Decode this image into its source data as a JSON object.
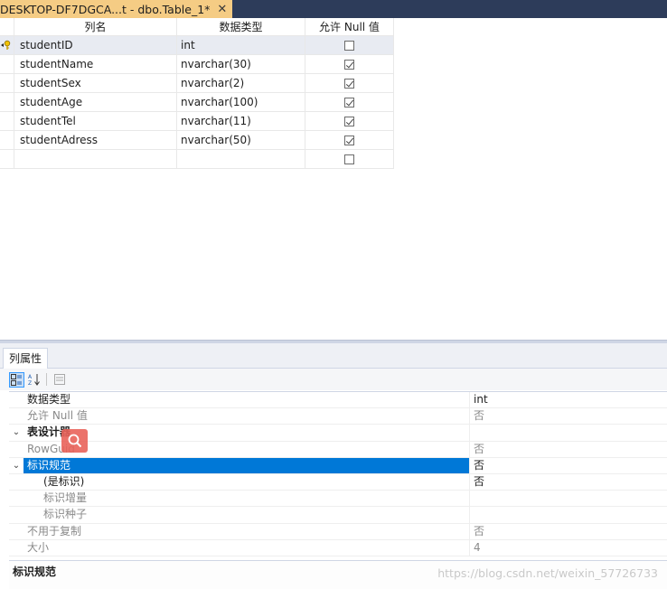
{
  "tab": {
    "title": "DESKTOP-DF7DGCA...t - dbo.Table_1*",
    "close_glyph": "✕"
  },
  "grid": {
    "headers": {
      "name": "列名",
      "type": "数据类型",
      "null": "允许 Null 值"
    },
    "rows": [
      {
        "name": "studentID",
        "type": "int",
        "allow_null": false,
        "primary_key": true
      },
      {
        "name": "studentName",
        "type": "nvarchar(30)",
        "allow_null": true
      },
      {
        "name": "studentSex",
        "type": "nvarchar(2)",
        "allow_null": true
      },
      {
        "name": "studentAge",
        "type": "nvarchar(100)",
        "allow_null": true
      },
      {
        "name": "studentTel",
        "type": "nvarchar(11)",
        "allow_null": true
      },
      {
        "name": "studentAdress",
        "type": "nvarchar(50)",
        "allow_null": true
      },
      {
        "name": "",
        "type": "",
        "allow_null": false
      }
    ]
  },
  "props": {
    "tab_label": "列属性",
    "rows": [
      {
        "name": "数据类型",
        "value": "int"
      },
      {
        "name": "允许 Null 值",
        "value": "否"
      },
      {
        "name": "表设计器",
        "value": ""
      },
      {
        "name": "RowGuid",
        "value": "否"
      },
      {
        "name": "标识规范",
        "value": "否"
      },
      {
        "name": "(是标识)",
        "value": "否"
      },
      {
        "name": "标识增量",
        "value": ""
      },
      {
        "name": "标识种子",
        "value": ""
      },
      {
        "name": "不用于复制",
        "value": "否"
      },
      {
        "name": "大小",
        "value": "4"
      }
    ],
    "description": "标识规范"
  },
  "watermark": "https://blog.csdn.net/weixin_57726733",
  "colors": {
    "tab_active": "#f5cc84",
    "title_bar": "#2d3c5a",
    "selection": "#0078d7"
  }
}
